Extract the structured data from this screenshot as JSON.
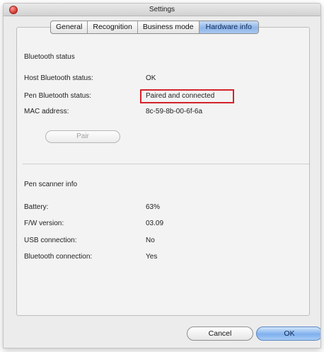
{
  "window": {
    "title": "Settings"
  },
  "tabs": [
    {
      "label": "General"
    },
    {
      "label": "Recognition"
    },
    {
      "label": "Business mode"
    },
    {
      "label": "Hardware info",
      "active": true
    }
  ],
  "bluetooth": {
    "section_title": "Bluetooth status",
    "rows": [
      {
        "label": "Host Bluetooth status:",
        "value": "OK"
      },
      {
        "label": "Pen Bluetooth status:",
        "value": "Paired and connected",
        "highlighted": true
      },
      {
        "label": "MAC address:",
        "value": "8c-59-8b-00-6f-6a"
      }
    ],
    "pair_button": "Pair"
  },
  "scanner": {
    "section_title": "Pen scanner info",
    "rows": [
      {
        "label": "Battery:",
        "value": "63%"
      },
      {
        "label": "F/W version:",
        "value": "03.09"
      },
      {
        "label": "USB connection:",
        "value": "No"
      },
      {
        "label": "Bluetooth connection:",
        "value": "Yes"
      }
    ]
  },
  "footer": {
    "cancel_label": "Cancel",
    "ok_label": "OK"
  },
  "colors": {
    "highlight_border": "#d4232b",
    "active_tab": "#9fc0ee",
    "window_bg": "#ececec"
  }
}
